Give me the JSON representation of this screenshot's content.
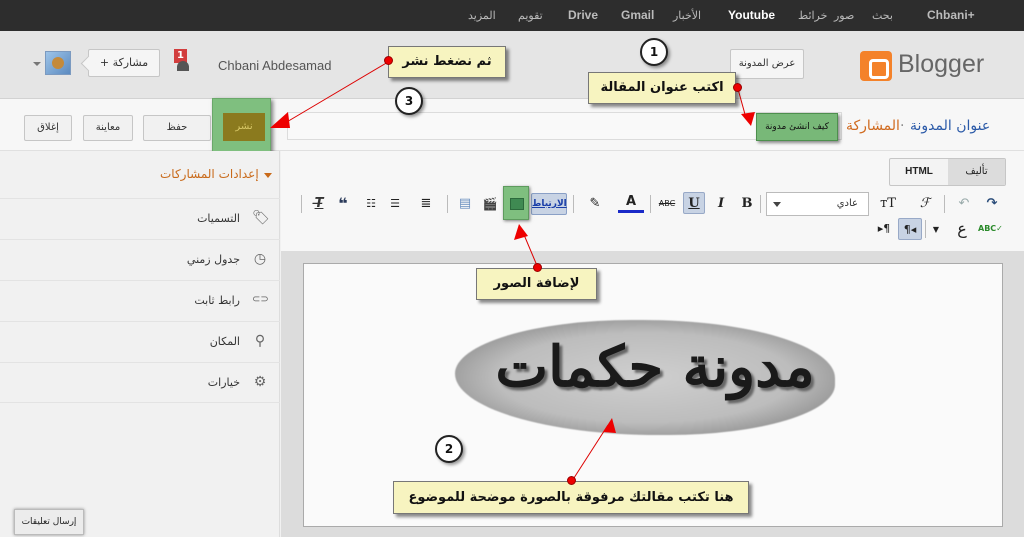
{
  "gbar": {
    "items": [
      {
        "label": "Chbani+",
        "active": false
      },
      {
        "label": "بحث",
        "active": false
      },
      {
        "label": "صور",
        "active": false
      },
      {
        "label": "خرائط",
        "active": false
      },
      {
        "label": "Youtube",
        "active": true
      },
      {
        "label": "الأخبار",
        "active": false
      },
      {
        "label": "Gmail",
        "active": false
      },
      {
        "label": "Drive",
        "active": false
      },
      {
        "label": "تقويم",
        "active": false
      },
      {
        "label": "المزيد",
        "active": false
      }
    ]
  },
  "header": {
    "logo_text": "Blogger",
    "view_blog_label": "عرض المدونة",
    "user_name": "Chbani Abdesamad",
    "notification_count": "1",
    "share_label": "+ مشاركة"
  },
  "title_row": {
    "breadcrumb_blog": "عنوان المدونة",
    "breadcrumb_separator": "·",
    "breadcrumb_post": "المشاركة",
    "post_title_value": "كيف انشئ مدونة",
    "publish_label": "نشر",
    "save_label": "حفظ",
    "preview_label": "معاينة",
    "close_label": "إغلاق"
  },
  "sidebar": {
    "heading": "إعدادات المشاركات",
    "items": [
      {
        "label": "التسميات",
        "icon": "tag-icon",
        "glyph": "🏷"
      },
      {
        "label": "جدول زمني",
        "icon": "clock-icon",
        "glyph": "◷"
      },
      {
        "label": "رابط ثابت",
        "icon": "link-icon",
        "glyph": "⊂⊃"
      },
      {
        "label": "المكان",
        "icon": "location-pin-icon",
        "glyph": "⚲"
      },
      {
        "label": "خيارات",
        "icon": "gear-icon",
        "glyph": "⚙"
      }
    ],
    "feedback_label": "إرسال تعليقات"
  },
  "editor": {
    "mode_html": "HTML",
    "mode_compose": "تأليف",
    "font_size_value": "عادي",
    "link_label": "الارتباط",
    "toolbar": {
      "redo": "↷",
      "undo": "↶",
      "font_family": "ℱ",
      "font_size": "тT",
      "bold": "B",
      "italic": "I",
      "underline": "U",
      "strike": "ABC",
      "text_color": "A",
      "highlight": "✎",
      "video": "🎬",
      "jump_break": "▤",
      "align": "≣",
      "numbered_list": "☰",
      "bullet_list": "☷",
      "quote": "❝",
      "remove_format": "T̶",
      "spellcheck": "ABC✓",
      "input_tools": "ع",
      "rtl": "¶◂",
      "ltr": "▸¶"
    },
    "image_text": "مدونة حكمات"
  },
  "annotations": {
    "step1_number": "1",
    "step1_text": "اكتب عنوان المقالة",
    "step2_number": "2",
    "step2_text": "هنا تكتب مقالتك مرفوقة بالصورة موضحة للموضوع",
    "step3_number": "3",
    "step3_text": "ثم نضغط نشر",
    "image_hint_text": "لإضافة الصور"
  }
}
